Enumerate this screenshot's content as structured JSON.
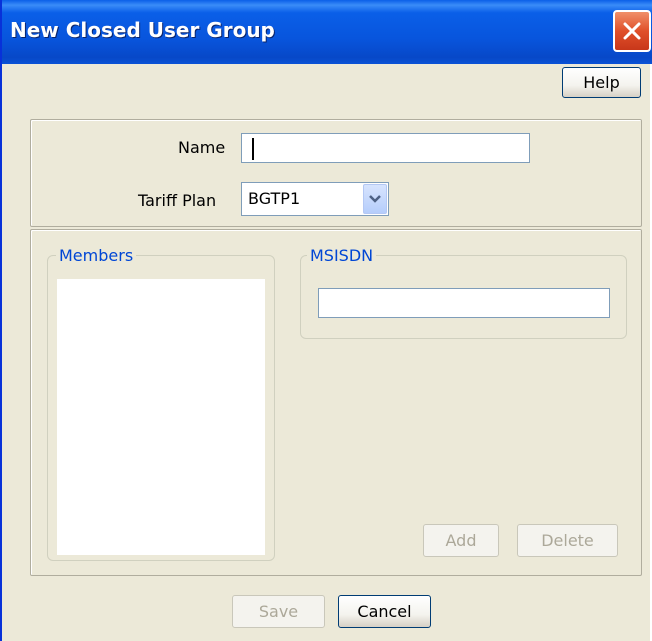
{
  "window": {
    "title": "New Closed User Group"
  },
  "toolbar": {
    "help_label": "Help"
  },
  "form": {
    "name_label": "Name",
    "name_value": "",
    "tariff_label": "Tariff Plan",
    "tariff_value": "BGTP1"
  },
  "members": {
    "legend": "Members",
    "items": []
  },
  "msisdn": {
    "legend": "MSISDN",
    "value": "",
    "add_label": "Add",
    "delete_label": "Delete"
  },
  "footer": {
    "save_label": "Save",
    "cancel_label": "Cancel"
  },
  "colors": {
    "title_bar": "#0a5fe8",
    "dialog_bg": "#ece9d8",
    "legend_text": "#0046d5",
    "close_button": "#e0502a"
  },
  "icons": {
    "close": "close-icon",
    "dropdown": "chevron-down-icon"
  }
}
